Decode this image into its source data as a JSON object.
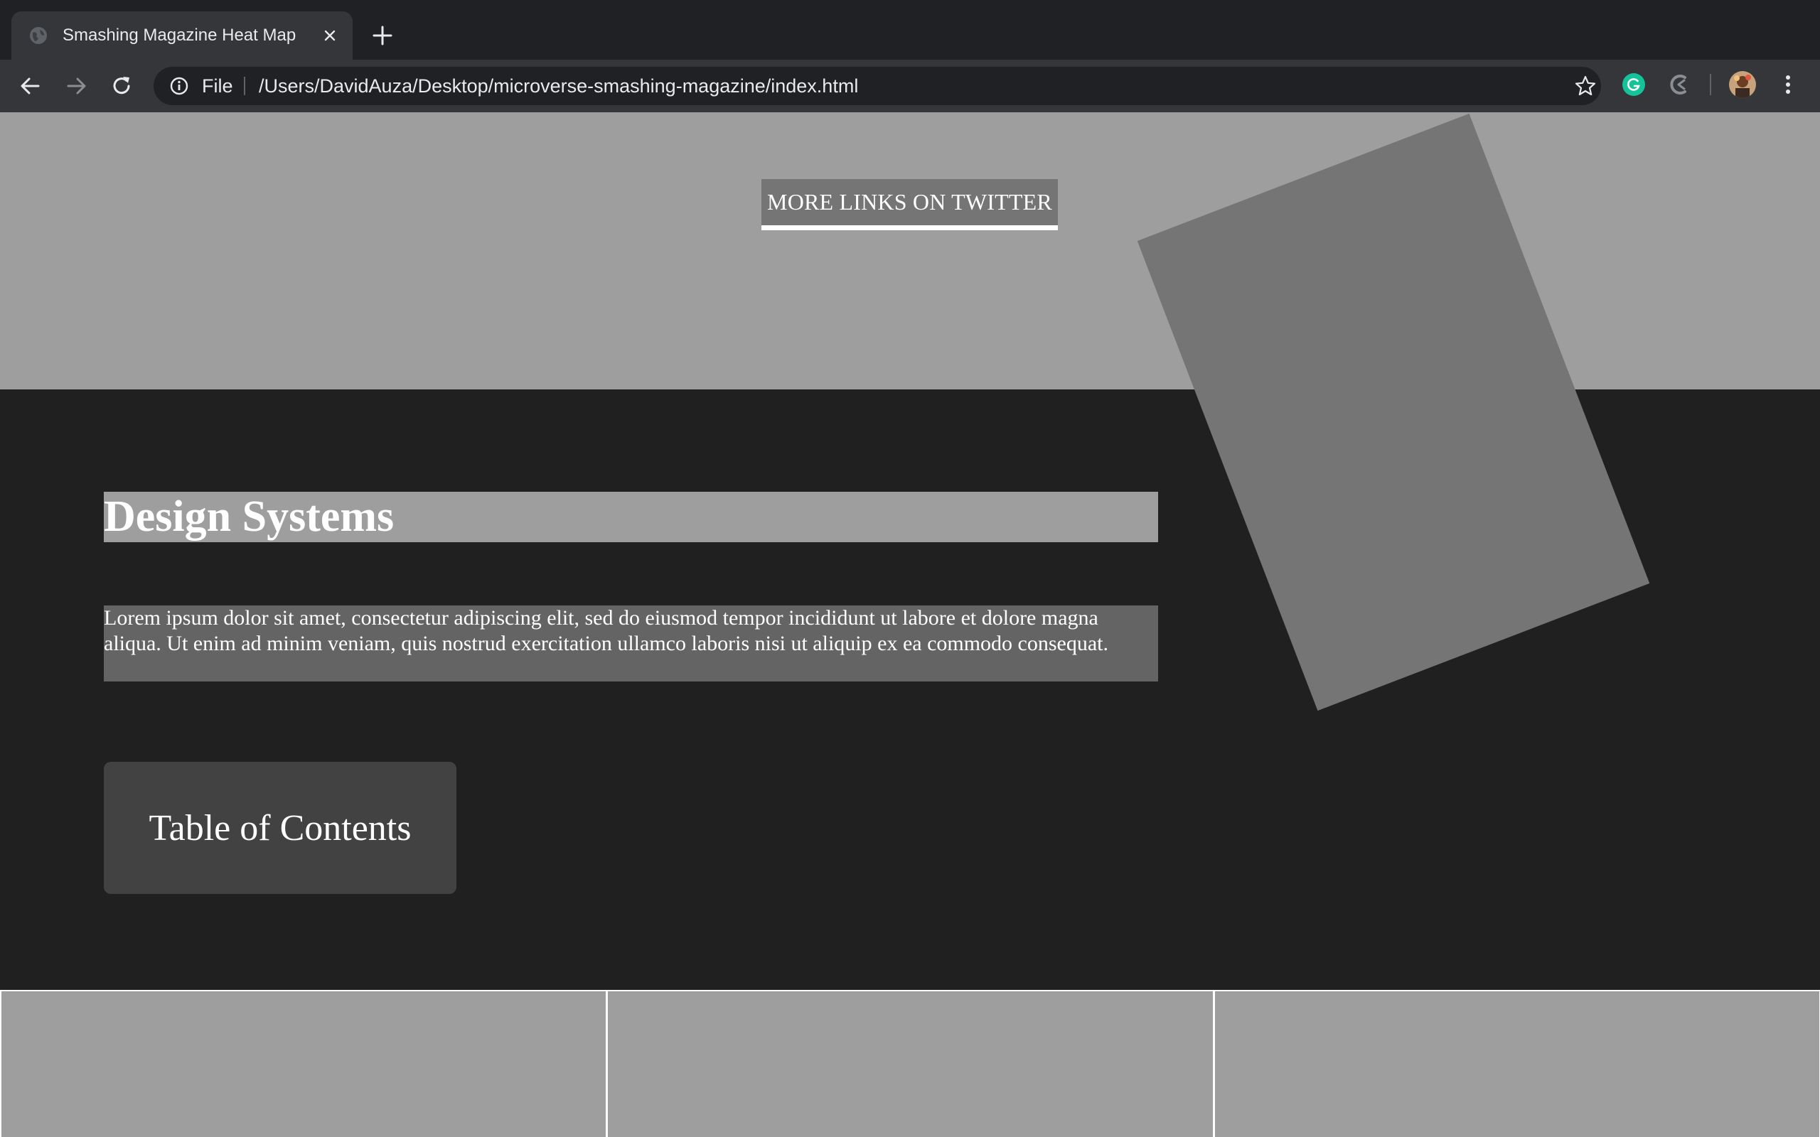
{
  "browser": {
    "tab": {
      "title": "Smashing Magazine Heat Map",
      "favicon": "globe-icon",
      "close": "close-icon"
    },
    "new_tab": "plus-icon",
    "nav": {
      "back": "back-arrow-icon",
      "forward": "forward-arrow-icon",
      "reload": "reload-icon"
    },
    "address_bar": {
      "info": "info-icon",
      "scheme_label": "File",
      "url": "/Users/DavidAuza/Desktop/microverse-smashing-magazine/index.html",
      "bookmark": "star-icon"
    },
    "extensions": [
      "grammarly-icon",
      "crescent-extension-icon"
    ],
    "profile": "avatar",
    "menu": "kebab-menu-icon"
  },
  "page": {
    "twitter_button_label": "MORE LINKS ON TWITTER",
    "heading": "Design Systems",
    "paragraph": "Lorem ipsum dolor sit amet, consectetur adipiscing elit, sed do eiusmod tempor incididunt ut labore et dolore magna aliqua. Ut enim ad minim veniam, quis nostrud exercitation ullamco laboris nisi ut aliquip ex ea commodo consequat.",
    "toc_button_label": "Table of Contents",
    "cards_count_visible": 3
  },
  "colors": {
    "chrome_dark": "#202124",
    "chrome_toolbar": "#35363a",
    "page_bg": "#202020",
    "light_gray": "#9e9e9e",
    "mid_gray": "#757575",
    "paragraph_bg": "#646464",
    "toc_bg": "#424242",
    "text_white": "#ffffff",
    "grammarly_green": "#15c39a"
  }
}
